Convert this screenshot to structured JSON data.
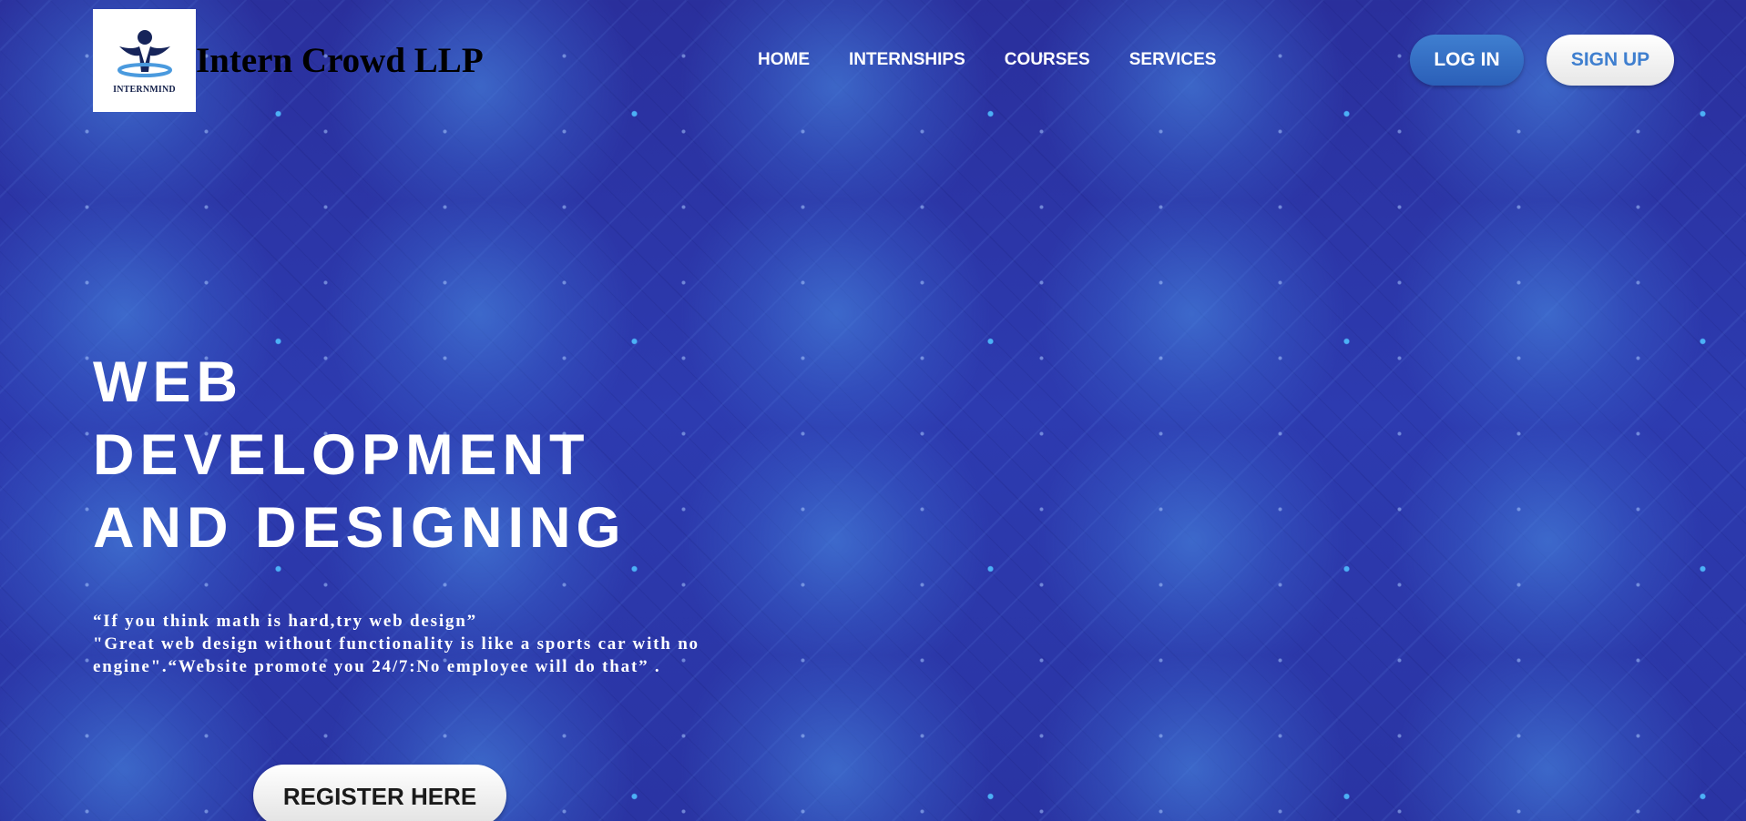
{
  "header": {
    "logo_text": "INTERNMIND",
    "brand_name": "Intern Crowd LLP",
    "nav": [
      {
        "label": "HOME"
      },
      {
        "label": "INTERNSHIPS"
      },
      {
        "label": "COURSES"
      },
      {
        "label": "SERVICES"
      }
    ],
    "login_label": "LOG IN",
    "signup_label": "SIGN UP"
  },
  "hero": {
    "title_lines": [
      "WEB",
      "DEVELOPMENT",
      "AND DESIGNING"
    ],
    "quote_line1": "“If you think math is hard,try web design”",
    "quote_line2": "\"Great web design without functionality is like a sports car with no engine\".“Website promote you 24/7:No employee will do that” .",
    "register_label": "REGISTER HERE"
  },
  "colors": {
    "background": "#2c36a6",
    "login_button": "#3170c4",
    "signup_text": "#3f7fcf",
    "text_light": "#ffffff",
    "brand_text": "#000000"
  }
}
